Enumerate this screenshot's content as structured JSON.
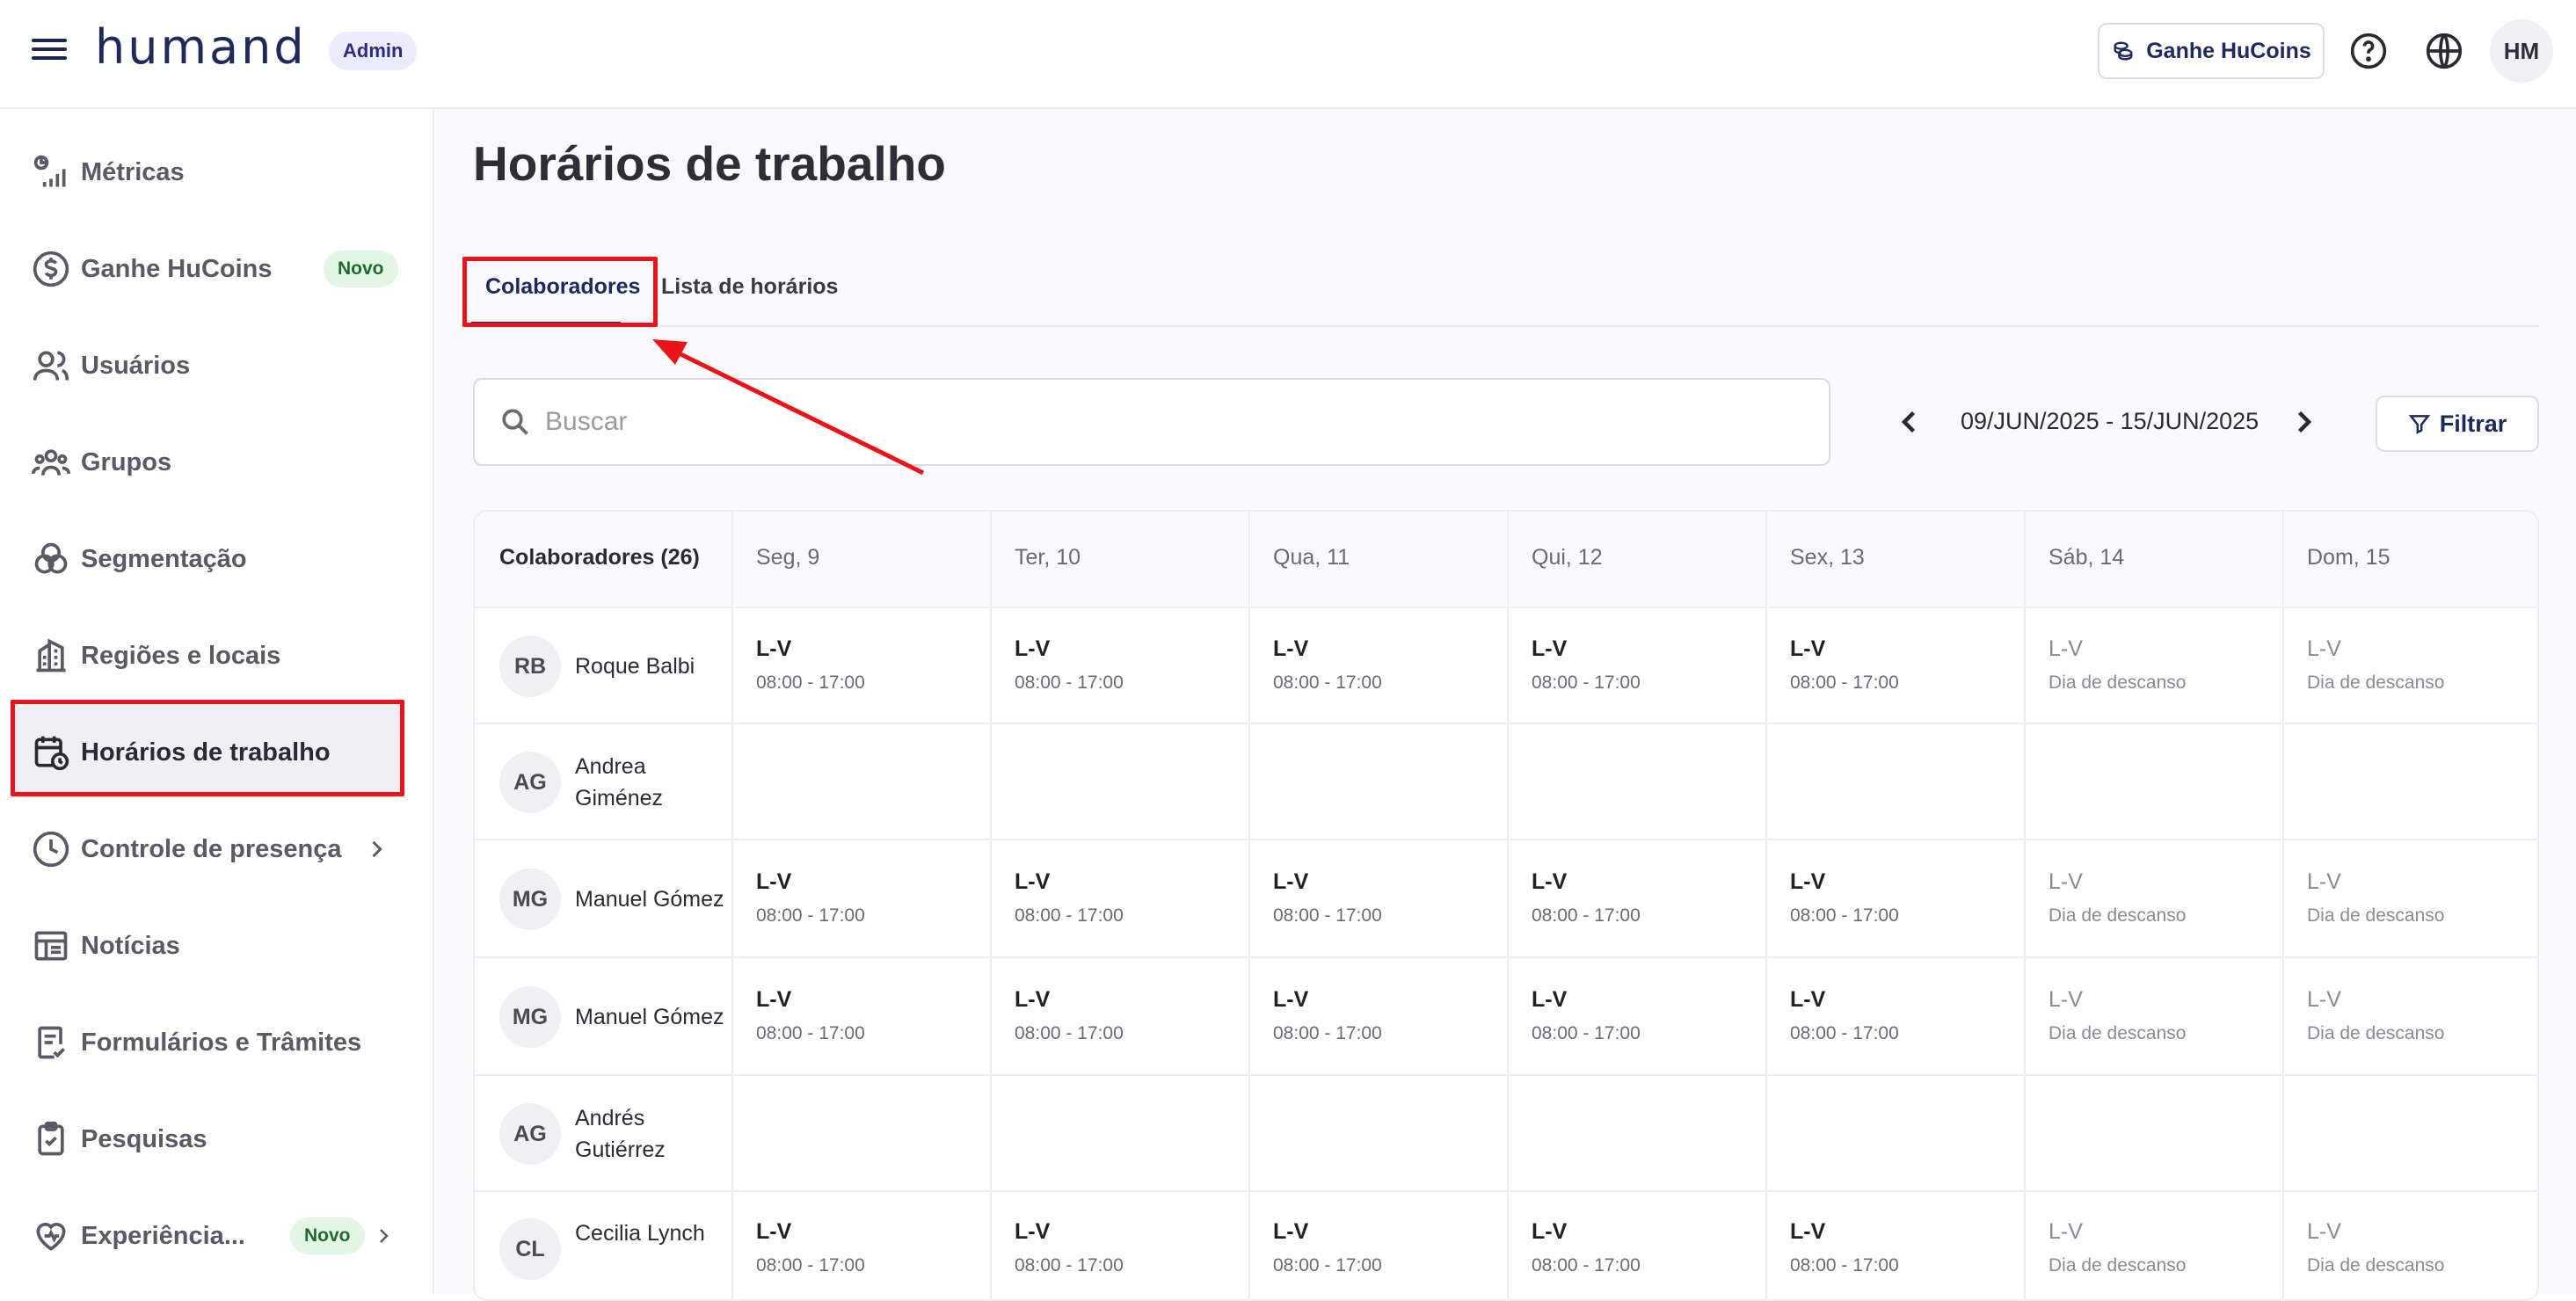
{
  "header": {
    "logo": "humand",
    "admin_badge": "Admin",
    "hucoins_button": "Ganhe HuCoins",
    "avatar_initials": "HM"
  },
  "sidebar": {
    "items": [
      {
        "label": "Métricas",
        "icon": "metrics-icon"
      },
      {
        "label": "Ganhe HuCoins",
        "icon": "dollar-icon",
        "badge": "Novo"
      },
      {
        "label": "Usuários",
        "icon": "users-icon"
      },
      {
        "label": "Grupos",
        "icon": "groups-icon"
      },
      {
        "label": "Segmentação",
        "icon": "segmentation-icon"
      },
      {
        "label": "Regiões e locais",
        "icon": "building-icon"
      },
      {
        "label": "Horários de trabalho",
        "icon": "calendar-clock-icon",
        "active": true
      },
      {
        "label": "Controle de presença",
        "icon": "clock-icon"
      },
      {
        "label": "Notícias",
        "icon": "news-icon"
      },
      {
        "label": "Formulários e Trâmites",
        "icon": "form-icon"
      },
      {
        "label": "Pesquisas",
        "icon": "clipboard-icon"
      },
      {
        "label": "Experiência...",
        "icon": "heart-icon",
        "badge": "Novo"
      }
    ]
  },
  "main": {
    "title": "Horários de trabalho",
    "tabs": [
      "Colaboradores",
      "Lista de horários"
    ],
    "search_placeholder": "Buscar",
    "date_range": "09/JUN/2025 - 15/JUN/2025",
    "filter_button": "Filtrar"
  },
  "table": {
    "columns": [
      "Colaboradores (26)",
      "Seg, 9",
      "Ter, 10",
      "Qua, 11",
      "Qui, 12",
      "Sex, 13",
      "Sáb, 14",
      "Dom, 15"
    ],
    "schedule_code": "L-V",
    "work_hours": "08:00 - 17:00",
    "rest_label": "Dia de descanso",
    "rows": [
      {
        "initials": "RB",
        "name": "Roque Balbi",
        "has_schedule": true
      },
      {
        "initials": "AG",
        "name": "Andrea Giménez",
        "has_schedule": false
      },
      {
        "initials": "MG",
        "name": "Manuel Gómez",
        "has_schedule": true
      },
      {
        "initials": "MG",
        "name": "Manuel Gómez",
        "has_schedule": true
      },
      {
        "initials": "AG",
        "name": "Andrés Gutiérrez",
        "has_schedule": false
      },
      {
        "initials": "CL",
        "name": "Cecilia Lynch",
        "has_schedule": true
      }
    ]
  },
  "colors": {
    "primary": "#1f2a5c",
    "highlight": "#e8141a",
    "novo_bg": "#e3f6e6",
    "novo_text": "#23682f"
  }
}
